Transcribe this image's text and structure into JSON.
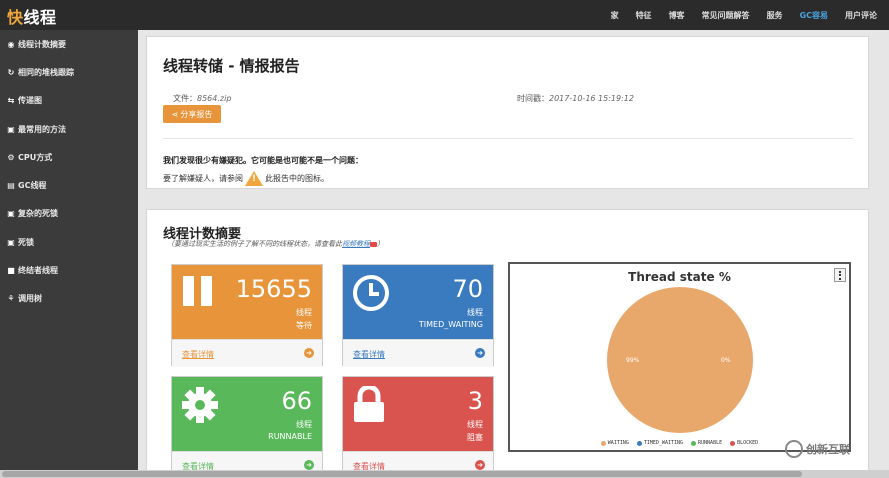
{
  "app": {
    "brand_prefix": "快",
    "brand_rest": "线程"
  },
  "topnav": [
    "家",
    "特征",
    "博客",
    "常见问题解答",
    "服务",
    "GC容易",
    "用户评论"
  ],
  "sidebar": [
    {
      "icon": "dashboard-icon",
      "glyph": "◉",
      "label": "线程计数摘要"
    },
    {
      "icon": "refresh-icon",
      "glyph": "↻",
      "label": "相同的堆栈跟踪"
    },
    {
      "icon": "share-icon",
      "glyph": "⇆",
      "label": "传递图"
    },
    {
      "icon": "lock-icon",
      "glyph": "▣",
      "label": "最常用的方法"
    },
    {
      "icon": "gears-icon",
      "glyph": "⚙",
      "label": "CPU方式"
    },
    {
      "icon": "trash-icon",
      "glyph": "▤",
      "label": "GC线程"
    },
    {
      "icon": "lock-icon",
      "glyph": "▣",
      "label": "复杂的死锁"
    },
    {
      "icon": "lock-icon",
      "glyph": "▣",
      "label": "死锁"
    },
    {
      "icon": "square-icon",
      "glyph": "■",
      "label": "终结者线程"
    },
    {
      "icon": "tree-icon",
      "glyph": "⚘",
      "label": "调用树"
    }
  ],
  "report": {
    "title": "线程转储 - 情报报告",
    "file_label": "文件：",
    "file_value": "8564.zip",
    "time_label": "时间戳：",
    "time_value": "2017-10-16 15:19:12",
    "share_label": "分享报告",
    "msg1": "我们发现很少有嫌疑犯。它可能是也可能不是一个问题：",
    "msg2_a": "要了解嫌疑人，请参阅",
    "msg2_b": "此报告中的图标。"
  },
  "summary": {
    "title": "线程计数摘要",
    "subtitle_a": "（要通过现实生活的例子了解不同的线程状态，请查看此",
    "subtitle_link": "视频教程",
    "subtitle_b": "）"
  },
  "cards": [
    {
      "count": "15655",
      "l1": "线程",
      "l2": "等待",
      "link": "查看详情",
      "icon": "pause-icon"
    },
    {
      "count": "70",
      "l1": "线程",
      "l2": "TIMED_WAITING",
      "link": "查看详情",
      "icon": "clock-icon"
    },
    {
      "count": "66",
      "l1": "线程",
      "l2": "RUNNABLE",
      "link": "查看详情",
      "icon": "gear-icon"
    },
    {
      "count": "3",
      "l1": "线程",
      "l2": "阻塞",
      "link": "查看详情",
      "icon": "lock-icon"
    }
  ],
  "chart_data": {
    "type": "pie",
    "title": "Thread state %",
    "slices": [
      {
        "name": "WAITING",
        "value": 99,
        "color": "#e9a86b"
      },
      {
        "name": "TIMED_WAITING",
        "value": 0,
        "color": "#3a7bbf"
      },
      {
        "name": "RUNNABLE",
        "value": 0,
        "color": "#58b85a"
      },
      {
        "name": "BLOCKED",
        "value": 0,
        "color": "#d9534f"
      }
    ],
    "slice_labels": [
      "99%",
      "0%"
    ],
    "legend_position": "bottom"
  },
  "watermark": "创新互联"
}
